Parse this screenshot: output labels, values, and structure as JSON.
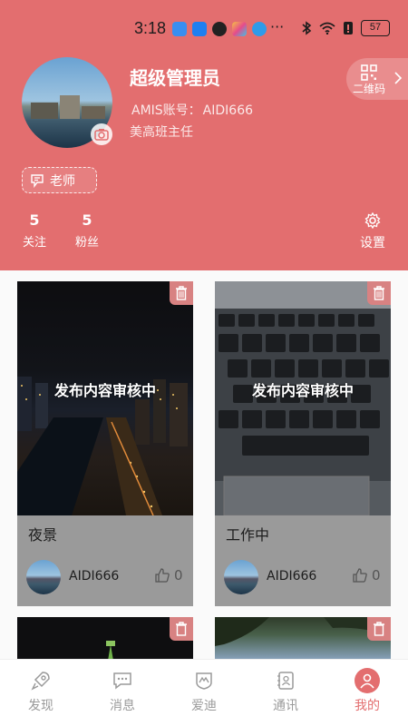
{
  "status_bar": {
    "time": "3:18",
    "battery": "57",
    "more": "···"
  },
  "profile": {
    "name": "超级管理员",
    "account_label": "AMIS账号：",
    "account_value": "AIDI666",
    "title": "美高班主任",
    "role": "老师",
    "qrcode_label": "二维码"
  },
  "stats": [
    {
      "num": "5",
      "label": "关注"
    },
    {
      "num": "5",
      "label": "粉丝"
    }
  ],
  "settings_label": "设置",
  "posts": [
    {
      "status": "发布内容审核中",
      "caption": "夜景",
      "author": "AIDI666",
      "likes": "0"
    },
    {
      "status": "发布内容审核中",
      "caption": "工作中",
      "author": "AIDI666",
      "likes": "0"
    }
  ],
  "tabs": [
    {
      "label": "发现",
      "icon": "rocket-icon"
    },
    {
      "label": "消息",
      "icon": "chat-icon"
    },
    {
      "label": "爱迪",
      "icon": "shield-icon"
    },
    {
      "label": "通讯",
      "icon": "contacts-icon"
    },
    {
      "label": "我的",
      "icon": "user-icon",
      "active": true
    }
  ],
  "colors": {
    "accent": "#e36e6f",
    "tab_inactive": "#9a9a9a"
  }
}
